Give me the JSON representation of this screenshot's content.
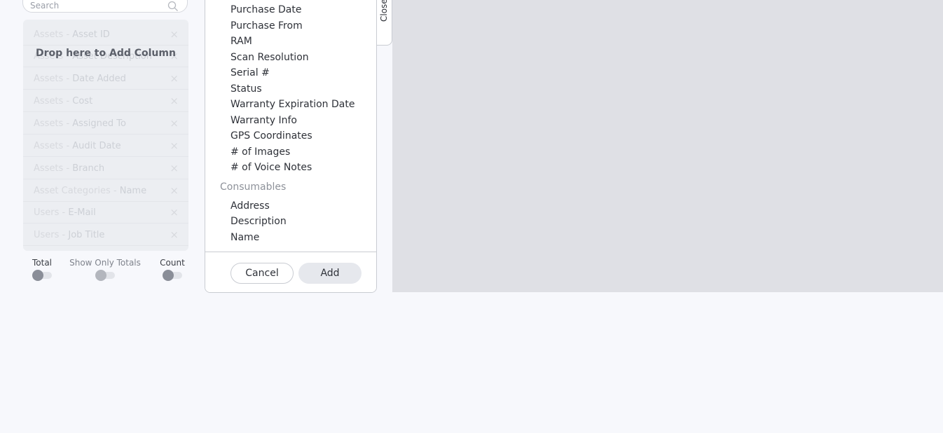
{
  "search": {
    "placeholder": "Search"
  },
  "drop_zone": {
    "label": "Drop here to Add Column",
    "rows": [
      {
        "entity": "Assets",
        "field": "Asset ID"
      },
      {
        "entity": "Assets",
        "field": "Asset Description"
      },
      {
        "entity": "Assets",
        "field": "Date Added"
      },
      {
        "entity": "Assets",
        "field": "Cost"
      },
      {
        "entity": "Assets",
        "field": "Assigned To"
      },
      {
        "entity": "Assets",
        "field": "Audit Date"
      },
      {
        "entity": "Assets",
        "field": "Branch"
      },
      {
        "entity": "Asset Categories",
        "field": "Name"
      },
      {
        "entity": "Users",
        "field": "E-Mail"
      },
      {
        "entity": "Users",
        "field": "Job Title"
      }
    ],
    "separator": " - ",
    "remove_glyph": "×"
  },
  "toggles": {
    "total": "Total",
    "show_only_totals": "Show Only Totals",
    "count": "Count"
  },
  "field_panel": {
    "assets_items": [
      "Purchase Date",
      "Purchase From",
      "RAM",
      "Scan Resolution",
      "Serial #",
      "Status",
      "Warranty Expiration Date",
      "Warranty Info",
      "GPS Coordinates",
      "# of Images",
      "# of Voice Notes"
    ],
    "consumables_header": "Consumables",
    "consumables_items": [
      "Address",
      "Description",
      "Name"
    ],
    "cancel_label": "Cancel",
    "add_label": "Add"
  },
  "close_tab": {
    "label": "Close"
  },
  "colors": {
    "accent_gray": "#8a8e98",
    "panel_border": "#c9ccd2",
    "preview_bg": "#dfe0e5"
  }
}
